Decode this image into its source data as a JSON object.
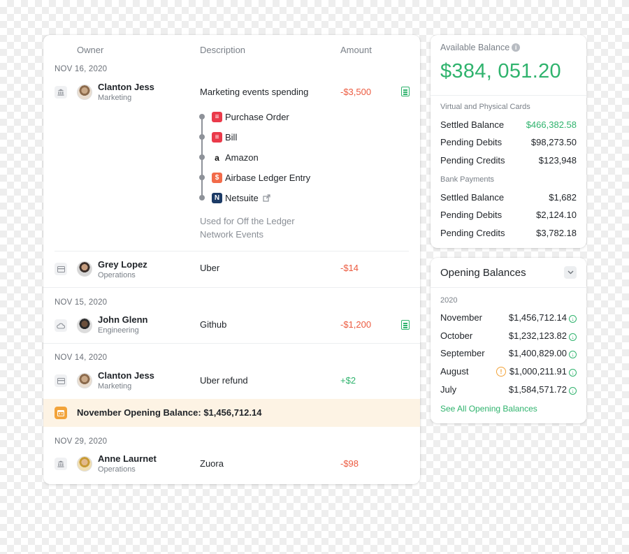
{
  "transactions": {
    "headers": {
      "owner": "Owner",
      "description": "Description",
      "amount": "Amount"
    },
    "groups": [
      {
        "date": "NOV 16, 2020"
      },
      {
        "date": "NOV 15, 2020"
      },
      {
        "date": "NOV 14, 2020"
      },
      {
        "date": "NOV 29, 2020"
      }
    ],
    "rows": [
      {
        "name": "Clanton Jess",
        "dept": "Marketing",
        "description": "Marketing events spending",
        "amount": "-$3,500",
        "type_icon": "bank-icon"
      },
      {
        "name": "Grey Lopez",
        "dept": "Operations",
        "description": "Uber",
        "amount": "-$14",
        "type_icon": "card-icon"
      },
      {
        "name": "John Glenn",
        "dept": "Engineering",
        "description": "Github",
        "amount": "-$1,200",
        "type_icon": "cloud-icon"
      },
      {
        "name": "Clanton Jess",
        "dept": "Marketing",
        "description": "Uber refund",
        "amount": "+$2",
        "type_icon": "card-icon"
      },
      {
        "name": "Anne Laurnet",
        "dept": "Operations",
        "description": "Zuora",
        "amount": "-$98",
        "type_icon": "bank-icon"
      }
    ],
    "timeline": [
      {
        "label": "Purchase Order",
        "icon": "purchase-order-icon",
        "color": "#ea3a4a"
      },
      {
        "label": "Bill",
        "icon": "bill-icon",
        "color": "#ea3a4a"
      },
      {
        "label": "Amazon",
        "icon": "amazon-icon",
        "color": "#ffffff"
      },
      {
        "label": "Airbase Ledger Entry",
        "icon": "dollar-icon",
        "color": "#f26b4a"
      },
      {
        "label": "Netsuite",
        "icon": "netsuite-icon",
        "color": "#1c3b66"
      }
    ],
    "note_line1": "Used for Off the Ledger",
    "note_line2": "Network Events",
    "banner": "November Opening Balance: $1,456,712.14"
  },
  "balance": {
    "label": "Available Balance",
    "amount": "$384, 051.20",
    "section1": "Virtual and Physical Cards",
    "cards": [
      {
        "label": "Settled Balance",
        "value": "$466,382.58"
      },
      {
        "label": "Pending Debits",
        "value": "$98,273.50"
      },
      {
        "label": "Pending Credits",
        "value": "$123,948"
      }
    ],
    "section2": "Bank Payments",
    "bank": [
      {
        "label": "Settled Balance",
        "value": "$1,682"
      },
      {
        "label": "Pending Debits",
        "value": "$2,124.10"
      },
      {
        "label": "Pending Credits",
        "value": "$3,782.18"
      }
    ]
  },
  "opening": {
    "title": "Opening Balances",
    "year": "2020",
    "months": [
      {
        "month": "November",
        "value": "$1,456,712.14"
      },
      {
        "month": "October",
        "value": "$1,232,123.82"
      },
      {
        "month": "September",
        "value": "$1,400,829.00"
      },
      {
        "month": "August",
        "value": "$1,000,211.91"
      },
      {
        "month": "July",
        "value": "$1,584,571.72"
      }
    ],
    "see_all": "See All Opening Balances"
  },
  "colors": {
    "green": "#2fb36d",
    "red": "#ec5a3f",
    "orange": "#f2a33a"
  }
}
